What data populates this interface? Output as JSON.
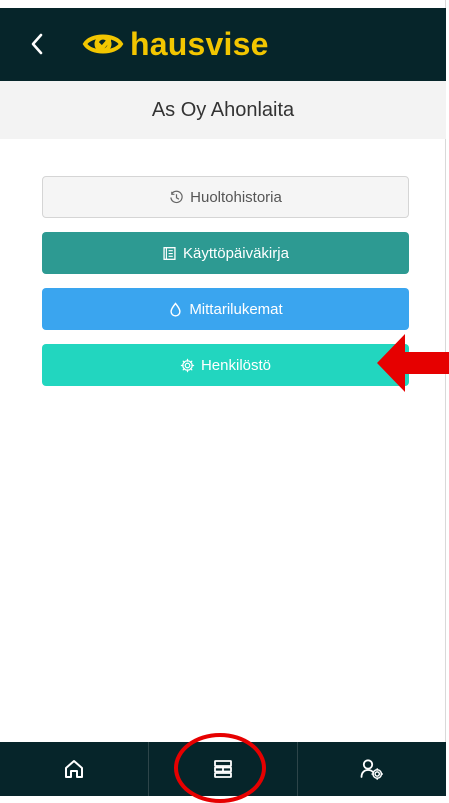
{
  "header": {
    "logo_text": "hausvise",
    "property_title": "As Oy Ahonlaita"
  },
  "menu": {
    "items": [
      {
        "label": "Huoltohistoria",
        "icon": "history-icon",
        "color": "#f5f5f5"
      },
      {
        "label": "Käyttöpäiväkirja",
        "icon": "book-icon",
        "color": "#2d9a92"
      },
      {
        "label": "Mittarilukemat",
        "icon": "water-drop-icon",
        "color": "#3aa5ef"
      },
      {
        "label": "Henkilöstö",
        "icon": "gear-icon",
        "color": "#22d6bf"
      }
    ]
  },
  "bottom_nav": {
    "items": [
      {
        "icon": "home-icon"
      },
      {
        "icon": "dashboard-icon"
      },
      {
        "icon": "user-settings-icon"
      }
    ]
  },
  "colors": {
    "topbar": "#06252a",
    "logo": "#f2c600",
    "annotation": "#e60000"
  }
}
